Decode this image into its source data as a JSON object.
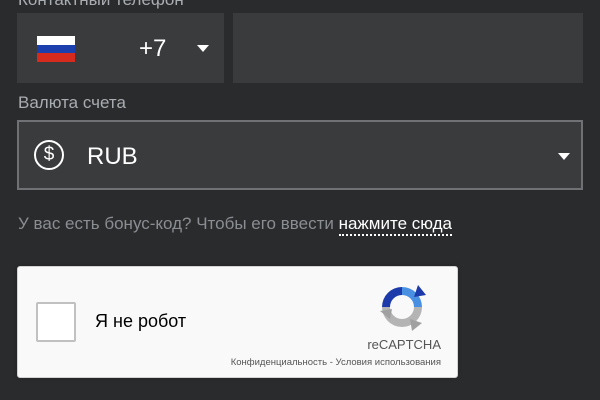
{
  "phone": {
    "label": "Контактный телефон",
    "country_code": "+7",
    "country_flag": "russia-flag-icon",
    "number_value": "",
    "flag_colors": [
      "#ffffff",
      "#1c3fae",
      "#d52b1e"
    ]
  },
  "currency": {
    "label": "Валюта счета",
    "icon": "dollar-circle-icon",
    "value": "RUB"
  },
  "bonus": {
    "text": "У вас есть бонус-код? Чтобы его ввести ",
    "link": "нажмите сюда"
  },
  "recaptcha": {
    "checkbox_label": "Я не робот",
    "brand": "reCAPTCHA",
    "privacy": "Конфиденциальность",
    "separator": " - ",
    "terms": "Условия использования"
  },
  "colors": {
    "background": "#2a2b2d",
    "field": "#3a3b3d",
    "label": "#a9acb0"
  }
}
